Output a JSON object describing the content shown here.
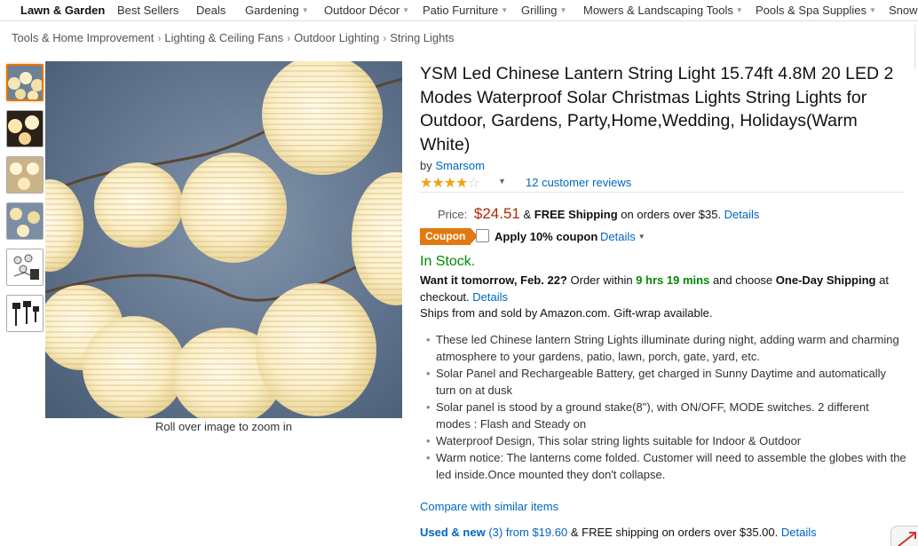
{
  "nav": {
    "items": [
      {
        "label": "Lawn & Garden",
        "dropdown": false
      },
      {
        "label": "Best Sellers",
        "dropdown": false
      },
      {
        "label": "Deals",
        "dropdown": false
      },
      {
        "label": "Gardening",
        "dropdown": true
      },
      {
        "label": "Outdoor Décor",
        "dropdown": true
      },
      {
        "label": "Patio Furniture",
        "dropdown": true
      },
      {
        "label": "Grilling",
        "dropdown": true
      },
      {
        "label": "Mowers & Landscaping Tools",
        "dropdown": true
      },
      {
        "label": "Pools & Spa Supplies",
        "dropdown": true
      },
      {
        "label": "Snow",
        "dropdown": false
      }
    ]
  },
  "breadcrumb": [
    "Tools & Home Improvement",
    "Lighting & Ceiling Fans",
    "Outdoor Lighting",
    "String Lights"
  ],
  "breadcrumb_separator": "›",
  "gallery": {
    "thumbnails": [
      "lanterns-row-thumbnail",
      "lanterns-dark-thumbnail",
      "lanterns-three-thumbnail",
      "lanterns-blue-thumbnail",
      "lanterns-package-thumbnail",
      "solar-stake-thumbnail"
    ],
    "zoom_hint": "Roll over image to zoom in"
  },
  "product": {
    "title": "YSM Led Chinese Lantern String Light 15.74ft 4.8M 20 LED 2 Modes Waterproof Solar Christmas Lights String Lights for Outdoor, Gardens, Party,Home,Wedding, Holidays(Warm White)",
    "by_prefix": "by",
    "brand": "Smarsom",
    "rating": 4,
    "rating_max": 5,
    "reviews": "12 customer reviews",
    "price_label": "Price:",
    "price": "$24.51",
    "ship_prefix": "&",
    "free_shipping": "FREE Shipping",
    "ship_suffix": "on orders over $35.",
    "ship_details": "Details",
    "coupon_badge": "Coupon",
    "coupon_text": "Apply 10% coupon",
    "coupon_details": "Details",
    "stock": "In Stock.",
    "delivery_want": "Want it tomorrow, Feb. 22?",
    "delivery_order": "Order within",
    "delivery_time": "9 hrs 19 mins",
    "delivery_choose": "and choose",
    "delivery_method": "One-Day Shipping",
    "delivery_at": "at checkout.",
    "delivery_details": "Details",
    "ships_from": "Ships from and sold by Amazon.com. Gift-wrap available.",
    "bullets": [
      "These led Chinese lantern String Lights illuminate during night, adding warm and charming atmosphere to your gardens, patio, lawn, porch, gate, yard, etc.",
      "Solar Panel and Rechargeable Battery, get charged in Sunny Daytime and automatically turn on at dusk",
      "Solar panel is stood by a ground stake(8\"), with ON/OFF, MODE switches. 2 different modes : Flash and Steady on",
      "Waterproof Design, This solar string lights suitable for Indoor & Outdoor",
      "Warm notice: The lanterns come folded. Customer will need to assemble the globes with the led inside.Once mounted they don't collapse."
    ],
    "compare": "Compare with similar items",
    "used_new_label": "Used & new",
    "used_new_count": "(3)",
    "used_new_from": "from",
    "used_new_price": "$19.60",
    "used_new_shipping": "& FREE shipping on orders over $35.00.",
    "used_new_details": "Details"
  },
  "colors": {
    "link": "#0066c0",
    "price": "#b12704",
    "in_stock": "#008a00",
    "coupon": "#e47911",
    "star": "#f0a112"
  }
}
